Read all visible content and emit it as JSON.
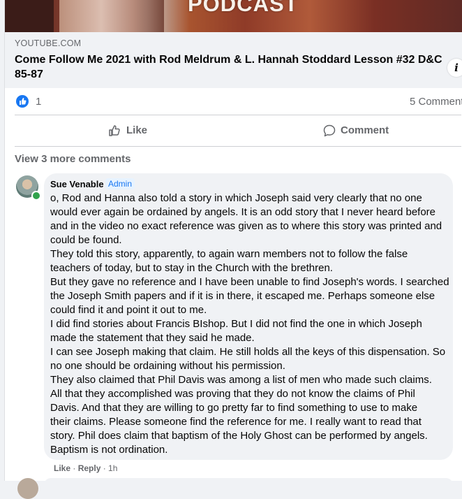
{
  "link": {
    "thumbnail_text": "PODCAST",
    "source": "YOUTUBE.COM",
    "title_line1": "Come Follow Me 2021 with Rod Meldrum & L. Hannah Stoddard Lesson #32 D&C",
    "title_line2": "85-87",
    "info_glyph": "i"
  },
  "reactions": {
    "icon": "like-reaction-icon",
    "like_count": "1",
    "comments_count": "5 Comment"
  },
  "actions": {
    "like_label": "Like",
    "comment_label": "Comment"
  },
  "comments": {
    "view_more": "View 3 more comments"
  },
  "comment": {
    "author": "Sue Venable",
    "badge": "Admin",
    "lines": [
      "o, Rod and Hanna also told a story in which Joseph said very clearly that no one",
      "would ever again be ordained by angels. It is an odd story that I never heard before",
      "and in the video no exact reference was given as to where this story was printed and",
      "could be found.",
      "They told this story, apparently, to again warn members not to follow the false",
      "teachers of today, but to stay in the Church with the brethren.",
      "But they gave no reference and I have been unable to find Joseph's words. I searched",
      "the Joseph Smith papers and if it is in there, it escaped me. Perhaps someone else",
      "could find it and point it out to me.",
      "I did find stories about Francis BIshop. But I did not find the one in which Joseph",
      "made the statement that they said he made.",
      "I can see Joseph making that claim. He still holds all the keys of this dispensation. So",
      "no one should be ordaining without his permission.",
      "They also claimed that Phil Davis was among a list of men who made such claims.",
      "All that they accomplished was proving that they do not know the claims of Phil",
      "Davis. And that they are willing to go pretty far to find something to use to make",
      "their claims. Please someone find the reference for me. I really want to read that",
      "story. Phil does claim that baptism of the Holy Ghost can be performed by angels.",
      "Baptism is not ordination."
    ],
    "like_action": "Like",
    "separator": " · ",
    "reply_action": "Reply",
    "time": "1h"
  }
}
